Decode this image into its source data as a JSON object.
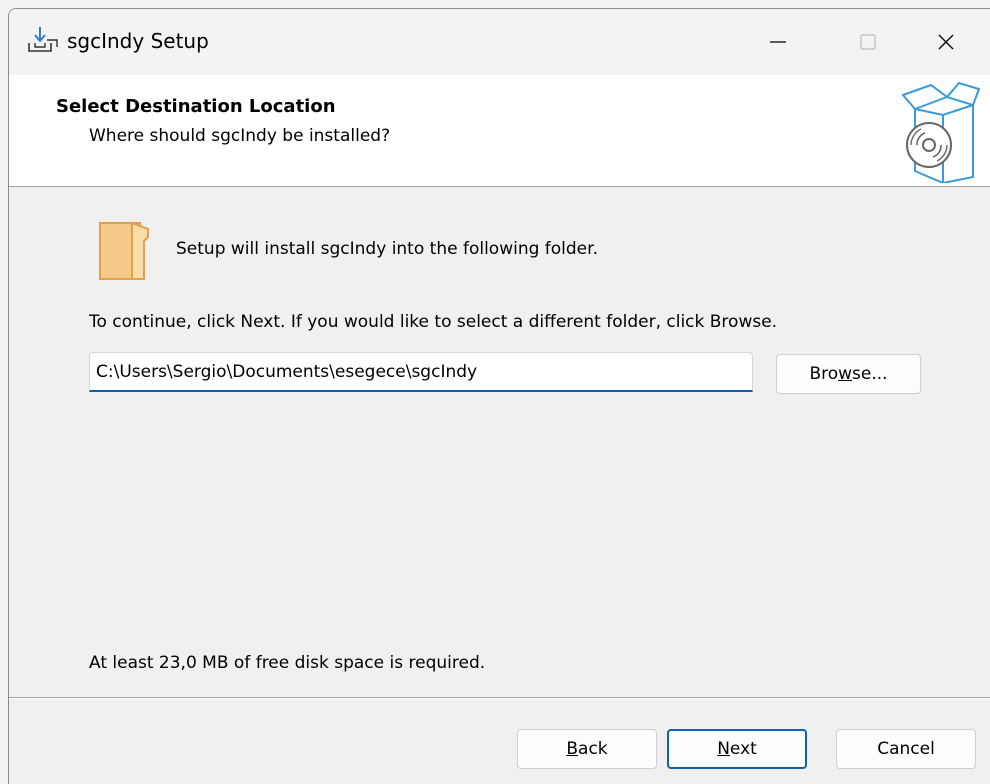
{
  "window": {
    "title": "sgcIndy Setup",
    "icon": "installer-download-icon",
    "controls": {
      "minimize_icon": "minimize-icon",
      "maximize_icon": "maximize-icon",
      "close_icon": "close-icon"
    }
  },
  "header": {
    "title": "Select Destination Location",
    "subtitle": "Where should sgcIndy be installed?",
    "icon": "box-with-disc-icon"
  },
  "content": {
    "folder_icon": "folder-icon",
    "intro": "Setup will install sgcIndy into the following folder.",
    "instructions": "To continue, click Next. If you would like to select a different folder, click Browse.",
    "path_value": "C:\\Users\\Sergio\\Documents\\esegece\\sgcIndy",
    "browse": {
      "prefix": "Bro",
      "underline": "w",
      "suffix": "se..."
    },
    "disk_space": "At least 23,0 MB of free disk space is required."
  },
  "footer": {
    "back": {
      "underline": "B",
      "suffix": "ack"
    },
    "next": {
      "underline": "N",
      "suffix": "ext"
    },
    "cancel": "Cancel"
  },
  "colors": {
    "accent": "#0f5fb4",
    "folder": "#f5c98a",
    "header_icon": "#3a9ad9"
  }
}
